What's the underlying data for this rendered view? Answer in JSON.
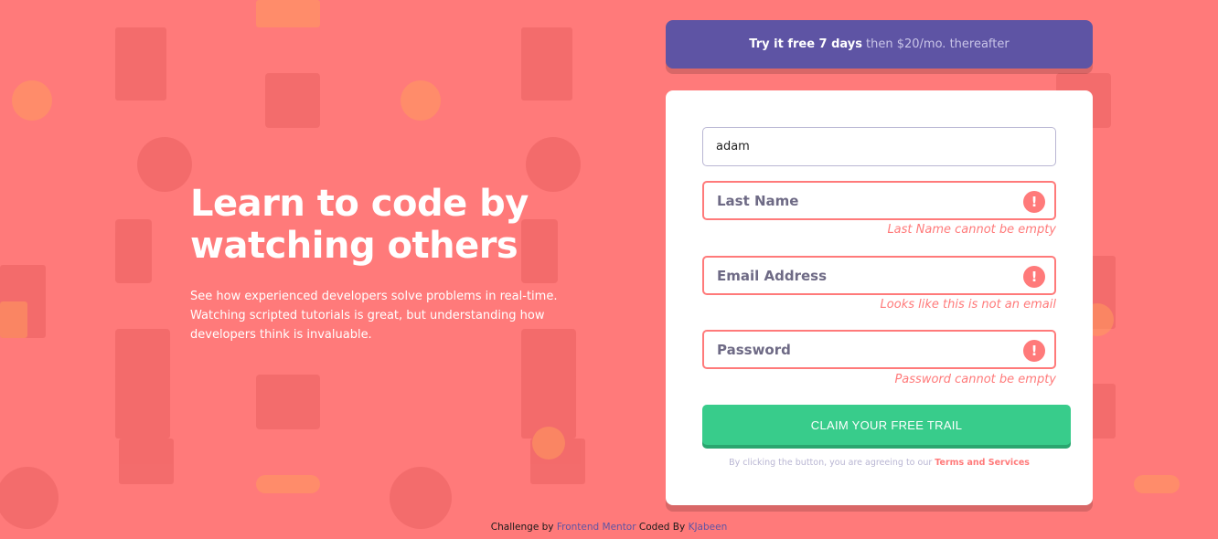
{
  "hero": {
    "title_line1": "Learn to code by",
    "title_line2": "watching others",
    "description": "See how experienced developers solve problems in real-time. Watching scripted tutorials is great, but understanding how developers think is invaluable."
  },
  "trial": {
    "strong": "Try it free 7 days",
    "light": "then $20/mo. thereafter"
  },
  "form": {
    "first_name_value": "adam",
    "last_name_placeholder": "Last Name",
    "last_name_error": "Last Name cannot be empty",
    "email_placeholder": "Email Address",
    "email_error": "Looks like this is not an email",
    "password_placeholder": "Password",
    "password_error": "Password cannot be empty",
    "error_icon_glyph": "!",
    "submit_label": "CLAIM YOUR FREE TRAIL",
    "terms_text": "By clicking the button, you are agreeing to our",
    "terms_link": "Terms and Services"
  },
  "footer": {
    "challenge_by": "Challenge by",
    "frontend_mentor": "Frontend Mentor",
    "coded_by": "Coded By",
    "author": "KJabeen"
  },
  "colors": {
    "background": "#ff7a7a",
    "banner": "#5e54a4",
    "button": "#38cc8b",
    "error": "#ff7a7a"
  },
  "icons": [
    "error-circle-icon"
  ]
}
